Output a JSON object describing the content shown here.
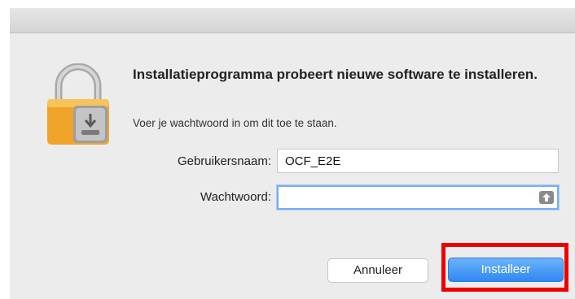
{
  "dialog": {
    "title": "Installatieprogramma probeert nieuwe software te installeren.",
    "subtitle": "Voer je wachtwoord in om dit toe te staan."
  },
  "form": {
    "username_label": "Gebruikersnaam:",
    "username_value": "OCF_E2E",
    "password_label": "Wachtwoord:",
    "password_value": ""
  },
  "buttons": {
    "cancel_label": "Annuleer",
    "install_label": "Installeer"
  },
  "icons": {
    "lock": "padlock-installer-icon",
    "password_key": "keychain-icon"
  },
  "colors": {
    "accent": "#2f88f3",
    "highlight": "#ee0000",
    "lock_gold": "#f0a52a"
  }
}
